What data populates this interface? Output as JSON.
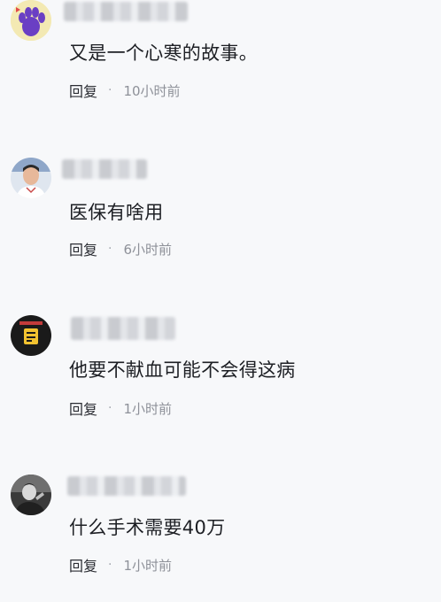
{
  "comments": [
    {
      "username": "",
      "text": "又是一个心寒的故事。",
      "reply_label": "回复",
      "separator": "·",
      "time": "10小时前",
      "avatar_icon": "paw-icon"
    },
    {
      "username": "",
      "text": "医保有啥用",
      "reply_label": "回复",
      "separator": "·",
      "time": "6小时前",
      "avatar_icon": "person-photo"
    },
    {
      "username": "",
      "text": "他要不献血可能不会得这病",
      "reply_label": "回复",
      "separator": "·",
      "time": "1小时前",
      "avatar_icon": "badge-icon"
    },
    {
      "username": "",
      "text": "什么手术需要40万",
      "reply_label": "回复",
      "separator": "·",
      "time": "1小时前",
      "avatar_icon": "monochrome-figure"
    }
  ]
}
